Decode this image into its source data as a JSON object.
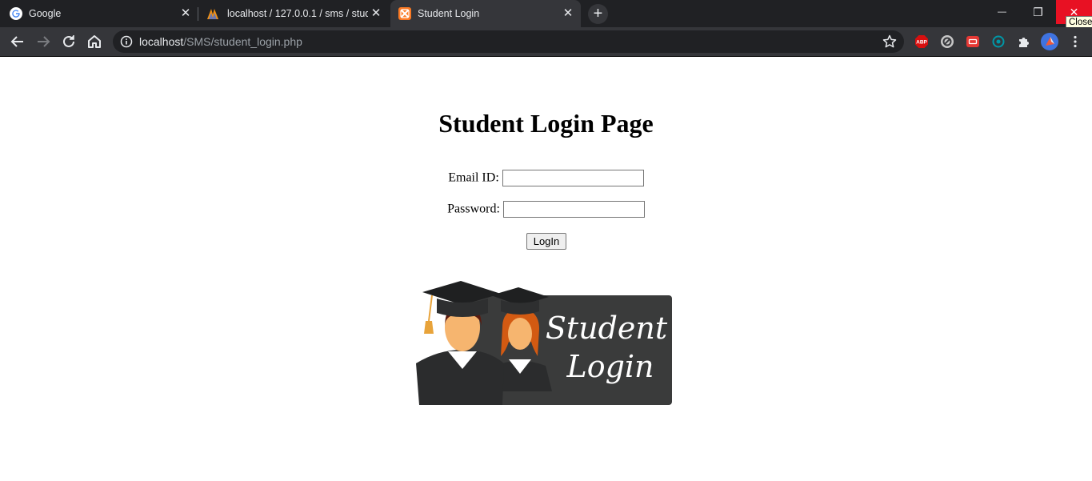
{
  "browser": {
    "tabs": [
      {
        "title": "Google",
        "favicon": "google-g-icon",
        "active": false
      },
      {
        "title": "localhost / 127.0.0.1 / sms / stude",
        "favicon": "phpmyadmin-icon",
        "active": false
      },
      {
        "title": "Student Login",
        "favicon": "xampp-icon",
        "active": true
      }
    ],
    "new_tab_label": "+",
    "window_controls": {
      "minimize": "—",
      "restore": "❐",
      "close": "✕"
    },
    "tooltip": "Close",
    "address": {
      "host": "localhost",
      "path": "/SMS/student_login.php"
    },
    "extensions": [
      "adblock-plus-icon",
      "block-site-icon",
      "video-ext-icon",
      "teal-circle-ext-icon",
      "puzzle-icon",
      "profile-avatar-icon",
      "menu-kebab-icon"
    ],
    "adblock_label": "ABP"
  },
  "page": {
    "heading": "Student Login Page",
    "email_label": "Email ID:",
    "email_value": "",
    "password_label": "Password:",
    "password_value": "",
    "login_button": "LogIn",
    "banner": {
      "line1": "Student",
      "line2": "Login",
      "colors": {
        "panel": "#3a3b3b",
        "gown": "#2b2c2d",
        "skin": "#f6b56f",
        "tassel": "#e8a33a"
      }
    }
  }
}
